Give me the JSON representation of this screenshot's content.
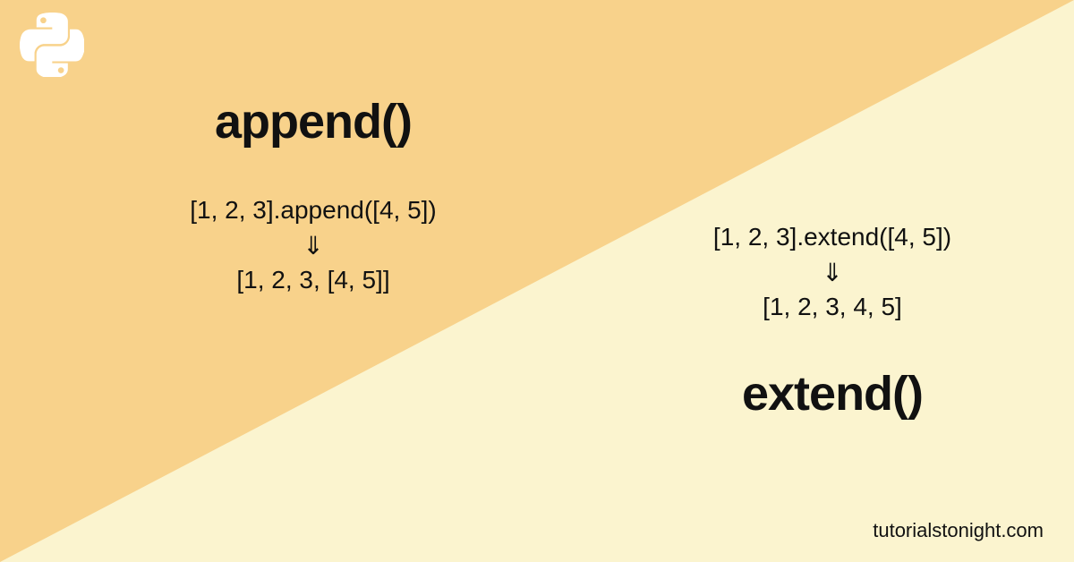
{
  "left": {
    "title": "append()",
    "input_code": "[1, 2, 3].append([4, 5])",
    "arrow": "⇓",
    "output_code": "[1, 2, 3, [4, 5]]"
  },
  "right": {
    "title": "extend()",
    "input_code": "[1, 2, 3].extend([4, 5])",
    "arrow": "⇓",
    "output_code": "[1, 2, 3, 4, 5]"
  },
  "attribution": "tutorialstonight.com",
  "icons": {
    "python": "python-logo-icon"
  }
}
